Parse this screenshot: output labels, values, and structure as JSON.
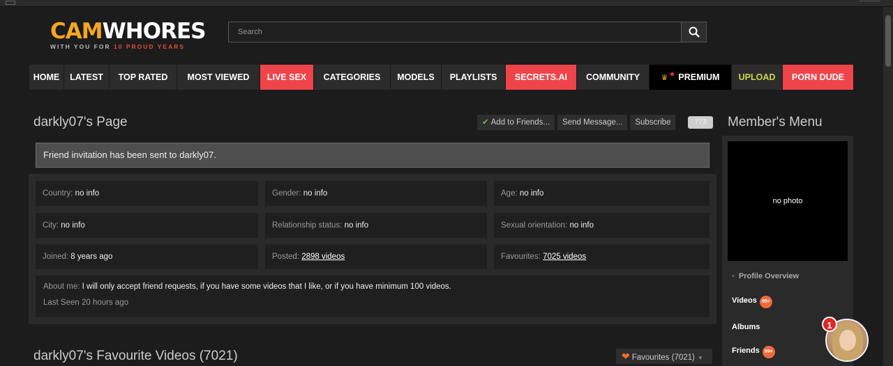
{
  "logo": {
    "cam": "CAM",
    "whores": "WHORES",
    "tag_pre": "WITH YOU FOR ",
    "tag_hl": "10 PROUD YEARS"
  },
  "search": {
    "placeholder": "Search"
  },
  "nav": [
    {
      "label": "HOME",
      "style": "normal"
    },
    {
      "label": "LATEST",
      "style": "normal"
    },
    {
      "label": "TOP RATED",
      "style": "normal"
    },
    {
      "label": "MOST VIEWED",
      "style": "normal"
    },
    {
      "label": "LIVE SEX",
      "style": "red"
    },
    {
      "label": "CATEGORIES",
      "style": "normal"
    },
    {
      "label": "MODELS",
      "style": "normal"
    },
    {
      "label": "PLAYLISTS",
      "style": "normal"
    },
    {
      "label": "SECRETS.AI",
      "style": "red"
    },
    {
      "label": "COMMUNITY",
      "style": "normal"
    },
    {
      "label": "PREMIUM",
      "style": "premium"
    },
    {
      "label": "UPLOAD",
      "style": "upload"
    },
    {
      "label": "PORN DUDE",
      "style": "red"
    }
  ],
  "page": {
    "title": "darkly07's Page",
    "add_friends": "Add to Friends...",
    "send_message": "Send Message...",
    "subscribe": "Subscribe",
    "count": "773",
    "notice": "Friend invitation has been sent to darkly07."
  },
  "info": {
    "country_label": "Country:",
    "country": "no info",
    "gender_label": "Gender:",
    "gender": "no info",
    "age_label": "Age:",
    "age": "no info",
    "city_label": "City:",
    "city": "no info",
    "relationship_label": "Relationship status:",
    "relationship": "no info",
    "orientation_label": "Sexual orientation:",
    "orientation": "no info",
    "joined_label": "Joined:",
    "joined": "8 years ago",
    "posted_label": "Posted:",
    "posted": "2898 videos",
    "favourites_label": "Favourites:",
    "favourites": "7025 videos",
    "about_label": "About me:",
    "about": "I will only accept friend requests, if you have some videos that I like, or if you have minimum 100 videos.",
    "last_seen": "Last Seen 20 hours ago"
  },
  "favs": {
    "title": "darkly07's Favourite Videos (7021)",
    "button": "Favourites (7021)"
  },
  "member_menu": {
    "title": "Member's Menu",
    "no_photo": "no photo",
    "overview": "Profile Overview",
    "videos": "Videos",
    "videos_badge": "99+",
    "albums": "Albums",
    "friends": "Friends",
    "friends_badge": "99+"
  },
  "chat": {
    "badge": "1"
  },
  "colors": {
    "accent_red": "#f0444b",
    "logo_orange": "#f5a623",
    "upload_green": "#c6d94a",
    "badge_orange": "#f26a3b"
  }
}
